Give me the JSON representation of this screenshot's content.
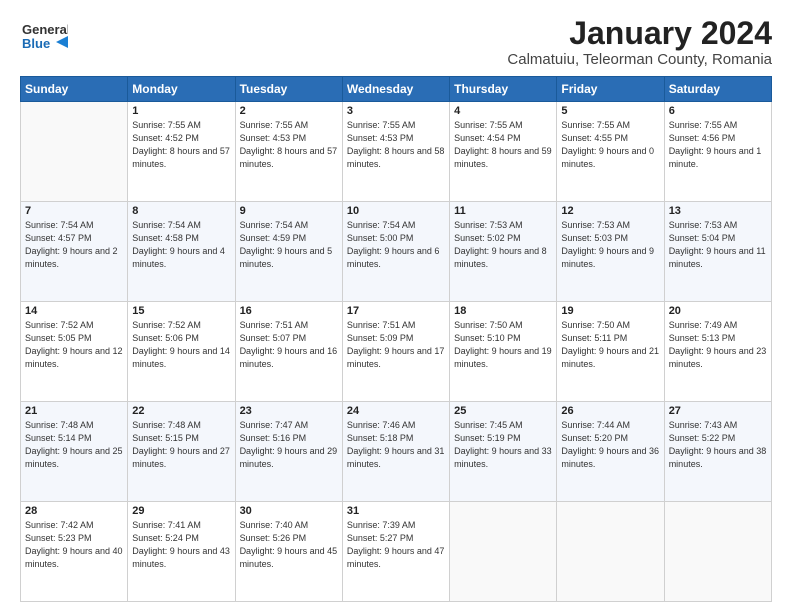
{
  "header": {
    "logo_line1": "General",
    "logo_line2": "Blue",
    "month": "January 2024",
    "location": "Calmatuiu, Teleorman County, Romania"
  },
  "days_of_week": [
    "Sunday",
    "Monday",
    "Tuesday",
    "Wednesday",
    "Thursday",
    "Friday",
    "Saturday"
  ],
  "weeks": [
    [
      {
        "day": "",
        "sunrise": "",
        "sunset": "",
        "daylight": ""
      },
      {
        "day": "1",
        "sunrise": "Sunrise: 7:55 AM",
        "sunset": "Sunset: 4:52 PM",
        "daylight": "Daylight: 8 hours and 57 minutes."
      },
      {
        "day": "2",
        "sunrise": "Sunrise: 7:55 AM",
        "sunset": "Sunset: 4:53 PM",
        "daylight": "Daylight: 8 hours and 57 minutes."
      },
      {
        "day": "3",
        "sunrise": "Sunrise: 7:55 AM",
        "sunset": "Sunset: 4:53 PM",
        "daylight": "Daylight: 8 hours and 58 minutes."
      },
      {
        "day": "4",
        "sunrise": "Sunrise: 7:55 AM",
        "sunset": "Sunset: 4:54 PM",
        "daylight": "Daylight: 8 hours and 59 minutes."
      },
      {
        "day": "5",
        "sunrise": "Sunrise: 7:55 AM",
        "sunset": "Sunset: 4:55 PM",
        "daylight": "Daylight: 9 hours and 0 minutes."
      },
      {
        "day": "6",
        "sunrise": "Sunrise: 7:55 AM",
        "sunset": "Sunset: 4:56 PM",
        "daylight": "Daylight: 9 hours and 1 minute."
      }
    ],
    [
      {
        "day": "7",
        "sunrise": "Sunrise: 7:54 AM",
        "sunset": "Sunset: 4:57 PM",
        "daylight": "Daylight: 9 hours and 2 minutes."
      },
      {
        "day": "8",
        "sunrise": "Sunrise: 7:54 AM",
        "sunset": "Sunset: 4:58 PM",
        "daylight": "Daylight: 9 hours and 4 minutes."
      },
      {
        "day": "9",
        "sunrise": "Sunrise: 7:54 AM",
        "sunset": "Sunset: 4:59 PM",
        "daylight": "Daylight: 9 hours and 5 minutes."
      },
      {
        "day": "10",
        "sunrise": "Sunrise: 7:54 AM",
        "sunset": "Sunset: 5:00 PM",
        "daylight": "Daylight: 9 hours and 6 minutes."
      },
      {
        "day": "11",
        "sunrise": "Sunrise: 7:53 AM",
        "sunset": "Sunset: 5:02 PM",
        "daylight": "Daylight: 9 hours and 8 minutes."
      },
      {
        "day": "12",
        "sunrise": "Sunrise: 7:53 AM",
        "sunset": "Sunset: 5:03 PM",
        "daylight": "Daylight: 9 hours and 9 minutes."
      },
      {
        "day": "13",
        "sunrise": "Sunrise: 7:53 AM",
        "sunset": "Sunset: 5:04 PM",
        "daylight": "Daylight: 9 hours and 11 minutes."
      }
    ],
    [
      {
        "day": "14",
        "sunrise": "Sunrise: 7:52 AM",
        "sunset": "Sunset: 5:05 PM",
        "daylight": "Daylight: 9 hours and 12 minutes."
      },
      {
        "day": "15",
        "sunrise": "Sunrise: 7:52 AM",
        "sunset": "Sunset: 5:06 PM",
        "daylight": "Daylight: 9 hours and 14 minutes."
      },
      {
        "day": "16",
        "sunrise": "Sunrise: 7:51 AM",
        "sunset": "Sunset: 5:07 PM",
        "daylight": "Daylight: 9 hours and 16 minutes."
      },
      {
        "day": "17",
        "sunrise": "Sunrise: 7:51 AM",
        "sunset": "Sunset: 5:09 PM",
        "daylight": "Daylight: 9 hours and 17 minutes."
      },
      {
        "day": "18",
        "sunrise": "Sunrise: 7:50 AM",
        "sunset": "Sunset: 5:10 PM",
        "daylight": "Daylight: 9 hours and 19 minutes."
      },
      {
        "day": "19",
        "sunrise": "Sunrise: 7:50 AM",
        "sunset": "Sunset: 5:11 PM",
        "daylight": "Daylight: 9 hours and 21 minutes."
      },
      {
        "day": "20",
        "sunrise": "Sunrise: 7:49 AM",
        "sunset": "Sunset: 5:13 PM",
        "daylight": "Daylight: 9 hours and 23 minutes."
      }
    ],
    [
      {
        "day": "21",
        "sunrise": "Sunrise: 7:48 AM",
        "sunset": "Sunset: 5:14 PM",
        "daylight": "Daylight: 9 hours and 25 minutes."
      },
      {
        "day": "22",
        "sunrise": "Sunrise: 7:48 AM",
        "sunset": "Sunset: 5:15 PM",
        "daylight": "Daylight: 9 hours and 27 minutes."
      },
      {
        "day": "23",
        "sunrise": "Sunrise: 7:47 AM",
        "sunset": "Sunset: 5:16 PM",
        "daylight": "Daylight: 9 hours and 29 minutes."
      },
      {
        "day": "24",
        "sunrise": "Sunrise: 7:46 AM",
        "sunset": "Sunset: 5:18 PM",
        "daylight": "Daylight: 9 hours and 31 minutes."
      },
      {
        "day": "25",
        "sunrise": "Sunrise: 7:45 AM",
        "sunset": "Sunset: 5:19 PM",
        "daylight": "Daylight: 9 hours and 33 minutes."
      },
      {
        "day": "26",
        "sunrise": "Sunrise: 7:44 AM",
        "sunset": "Sunset: 5:20 PM",
        "daylight": "Daylight: 9 hours and 36 minutes."
      },
      {
        "day": "27",
        "sunrise": "Sunrise: 7:43 AM",
        "sunset": "Sunset: 5:22 PM",
        "daylight": "Daylight: 9 hours and 38 minutes."
      }
    ],
    [
      {
        "day": "28",
        "sunrise": "Sunrise: 7:42 AM",
        "sunset": "Sunset: 5:23 PM",
        "daylight": "Daylight: 9 hours and 40 minutes."
      },
      {
        "day": "29",
        "sunrise": "Sunrise: 7:41 AM",
        "sunset": "Sunset: 5:24 PM",
        "daylight": "Daylight: 9 hours and 43 minutes."
      },
      {
        "day": "30",
        "sunrise": "Sunrise: 7:40 AM",
        "sunset": "Sunset: 5:26 PM",
        "daylight": "Daylight: 9 hours and 45 minutes."
      },
      {
        "day": "31",
        "sunrise": "Sunrise: 7:39 AM",
        "sunset": "Sunset: 5:27 PM",
        "daylight": "Daylight: 9 hours and 47 minutes."
      },
      {
        "day": "",
        "sunrise": "",
        "sunset": "",
        "daylight": ""
      },
      {
        "day": "",
        "sunrise": "",
        "sunset": "",
        "daylight": ""
      },
      {
        "day": "",
        "sunrise": "",
        "sunset": "",
        "daylight": ""
      }
    ]
  ]
}
